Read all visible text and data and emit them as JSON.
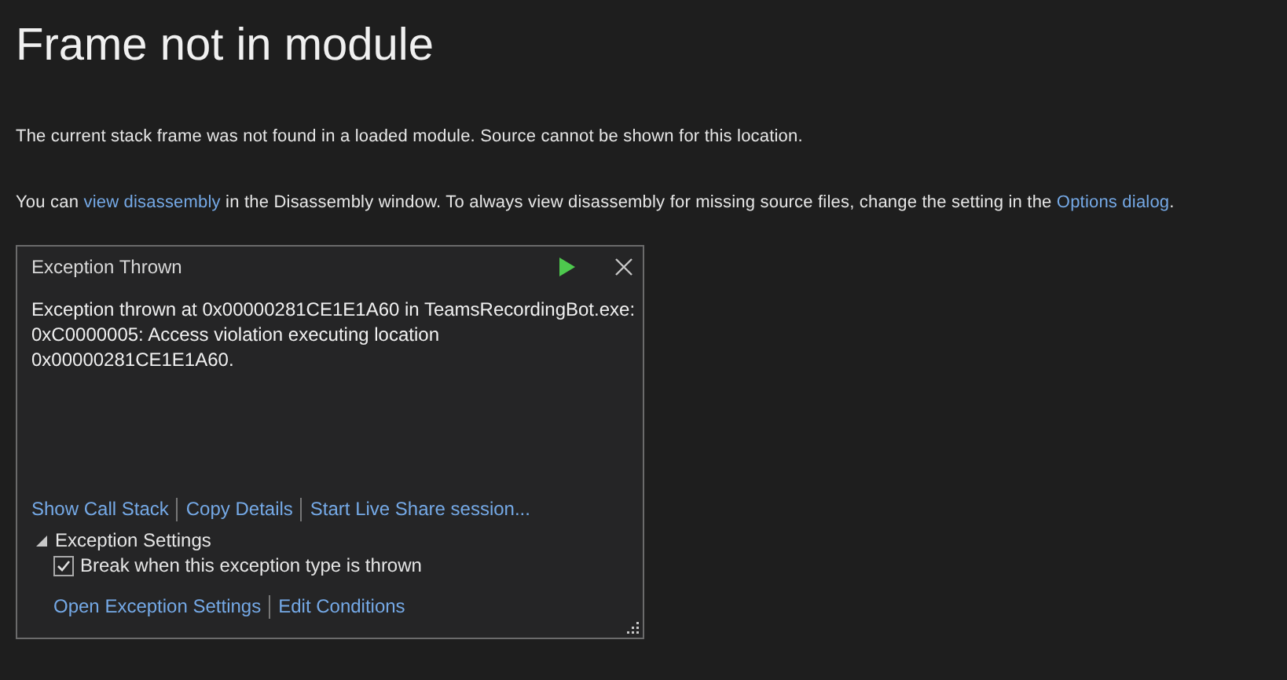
{
  "page": {
    "title": "Frame not in module",
    "message": "The current stack frame was not found in a loaded module. Source cannot be shown for this location.",
    "hint": [
      {
        "kind": "text",
        "text": "You can "
      },
      {
        "kind": "link",
        "text": "view disassembly"
      },
      {
        "kind": "text",
        "text": " in the Disassembly window. To always view disassembly for missing source files, change the setting in the "
      },
      {
        "kind": "link",
        "text": "Options dialog"
      },
      {
        "kind": "text",
        "text": "."
      }
    ]
  },
  "exception_popup": {
    "title": "Exception Thrown",
    "message": "Exception thrown at 0x00000281CE1E1A60 in TeamsRecordingBot.exe: 0xC0000005: Access violation executing location 0x00000281CE1E1A60.",
    "actions": [
      "Show Call Stack",
      "Copy Details",
      "Start Live Share session..."
    ],
    "settings": {
      "label": "Exception Settings",
      "expanded": true,
      "checkbox": {
        "label": "Break when this exception type is thrown",
        "checked": true
      },
      "links": [
        "Open Exception Settings",
        "Edit Conditions"
      ]
    }
  }
}
